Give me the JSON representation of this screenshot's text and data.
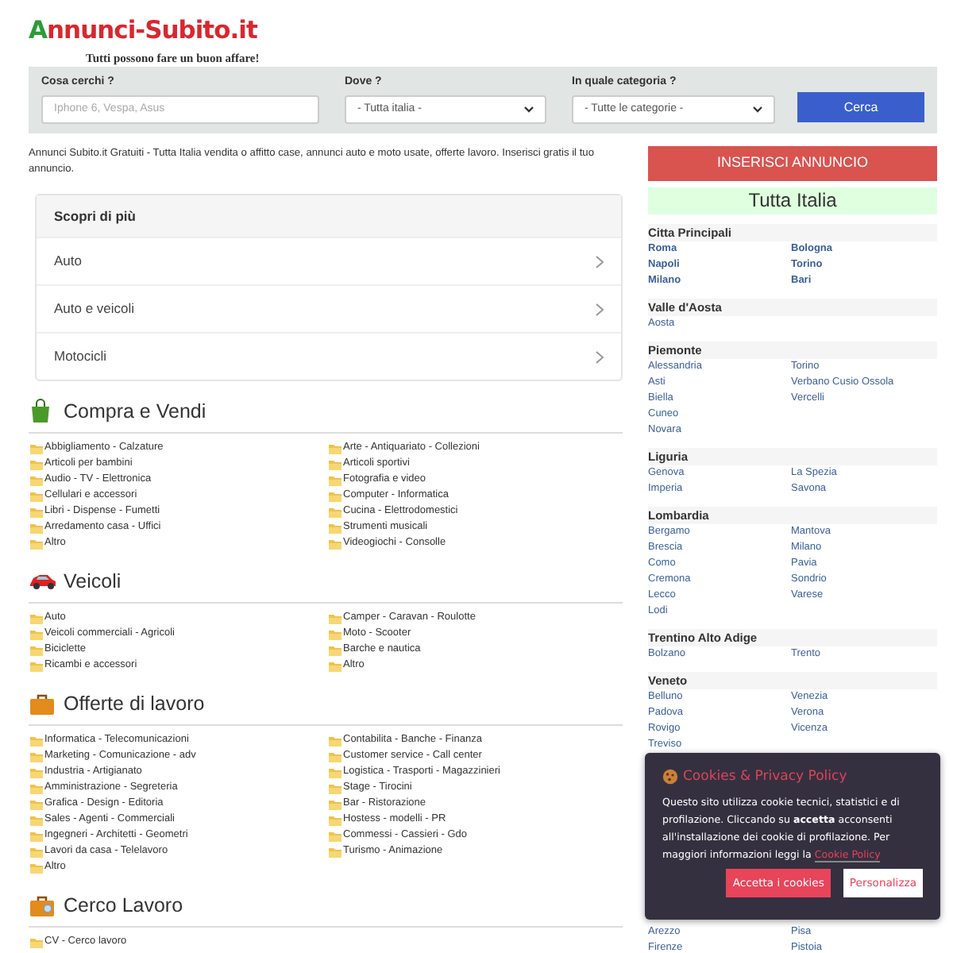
{
  "header": {
    "logo": "Annunci-Subito.it",
    "tagline": "Tutti possono fare un buon affare!"
  },
  "search": {
    "fields": [
      {
        "kind": "text",
        "label": "Cosa cerchi ?",
        "placeholder": "Iphone 6, Vespa, Asus"
      },
      {
        "kind": "select",
        "label": "Dove ?",
        "value": "- Tutta italia -"
      },
      {
        "kind": "select",
        "label": "In quale categoria ?",
        "value": "- Tutte le categorie -"
      }
    ],
    "button": "Cerca"
  },
  "intro": "Annunci Subito.it Gratuiti - Tutta Italia vendita o affitto case, annunci auto e moto usate, offerte lavoro. Inserisci gratis il tuo annuncio.",
  "discover": {
    "title": "Scopri di più",
    "items": [
      "Auto",
      "Auto e veicoli",
      "Motocicli"
    ]
  },
  "sections": [
    {
      "title": "Compra e Vendi",
      "kind": "bag",
      "columns": [
        [
          "Abbigliamento - Calzature",
          "Articoli per bambini",
          "Audio - TV - Elettronica",
          "Cellulari e accessori",
          "Libri - Dispense - Fumetti",
          "Arredamento casa - Uffici",
          "Altro"
        ],
        [
          "Arte - Antiquariato - Collezioni",
          "Articoli sportivi",
          "Fotografia e video",
          "Computer - Informatica",
          "Cucina - Elettrodomestici",
          "Strumenti musicali",
          "Videogiochi - Consolle"
        ]
      ]
    },
    {
      "title": "Veicoli",
      "kind": "car",
      "columns": [
        [
          "Auto",
          "Veicoli commerciali - Agricoli",
          "Biciclette",
          "Ricambi e accessori"
        ],
        [
          "Camper - Caravan - Roulotte",
          "Moto - Scooter",
          "Barche e nautica",
          "Altro"
        ]
      ]
    },
    {
      "title": "Offerte di lavoro",
      "kind": "jobs",
      "columns": [
        [
          "Informatica - Telecomunicazioni",
          "Marketing - Comunicazione - adv",
          "Industria - Artigianato",
          "Amministrazione - Segreteria",
          "Grafica - Design - Editoria",
          "Sales - Agenti - Commerciali",
          "Ingegneri - Architetti - Geometri",
          "Lavori da casa - Telelavoro",
          "Altro"
        ],
        [
          "Contabilita - Banche - Finanza",
          "Customer service - Call center",
          "Logistica - Trasporti - Magazzinieri",
          "Stage - Tirocini",
          "Bar - Ristorazione",
          "Hostess - modelli - PR",
          "Commessi - Cassieri - Gdo",
          "Turismo - Animazione"
        ]
      ]
    },
    {
      "title": "Cerco Lavoro",
      "kind": "job-search",
      "columns": [
        [
          "CV - Cerco lavoro"
        ],
        []
      ]
    }
  ],
  "sidebar": {
    "post_button": "INSERISCI ANNUNCIO",
    "area": "Tutta Italia",
    "regions": [
      {
        "name": "Citta Principali",
        "kind": "main",
        "columns": [
          [
            "Roma",
            "Napoli",
            "Milano"
          ],
          [
            "Bologna",
            "Torino",
            "Bari"
          ]
        ]
      },
      {
        "name": "Valle d'Aosta",
        "kind": "region",
        "columns": [
          [
            "Aosta"
          ],
          []
        ]
      },
      {
        "name": "Piemonte",
        "kind": "region",
        "columns": [
          [
            "Alessandria",
            "Asti",
            "Biella",
            "Cuneo",
            "Novara"
          ],
          [
            "Torino",
            "Verbano Cusio Ossola",
            "Vercelli"
          ]
        ]
      },
      {
        "name": "Liguria",
        "kind": "region",
        "columns": [
          [
            "Genova",
            "Imperia"
          ],
          [
            "La Spezia",
            "Savona"
          ]
        ]
      },
      {
        "name": "Lombardia",
        "kind": "region",
        "columns": [
          [
            "Bergamo",
            "Brescia",
            "Como",
            "Cremona",
            "Lecco",
            "Lodi"
          ],
          [
            "Mantova",
            "Milano",
            "Pavia",
            "Sondrio",
            "Varese"
          ]
        ]
      },
      {
        "name": "Trentino Alto Adige",
        "kind": "region",
        "columns": [
          [
            "Bolzano"
          ],
          [
            "Trento"
          ]
        ]
      },
      {
        "name": "Veneto",
        "kind": "region",
        "columns": [
          [
            "Belluno",
            "Padova",
            "Rovigo",
            "Treviso"
          ],
          [
            "Venezia",
            "Verona",
            "Vicenza"
          ]
        ]
      },
      {
        "kind": "covered",
        "columns": [
          [
            "Arezzo",
            "Firenze"
          ],
          [
            "Pisa",
            "Pistoia"
          ]
        ]
      }
    ]
  },
  "cookie_banner": {
    "title": "Cookies & Privacy Policy",
    "text": "Questo sito utilizza cookie tecnici, statistici e di profilazione. Cliccando su **accetta** acconsenti all'installazione dei cookie di profilazione. Per maggiori informazioni leggi la",
    "link": "Cookie Policy",
    "accept": "Accetta i cookies",
    "customize": "Personalizza"
  }
}
